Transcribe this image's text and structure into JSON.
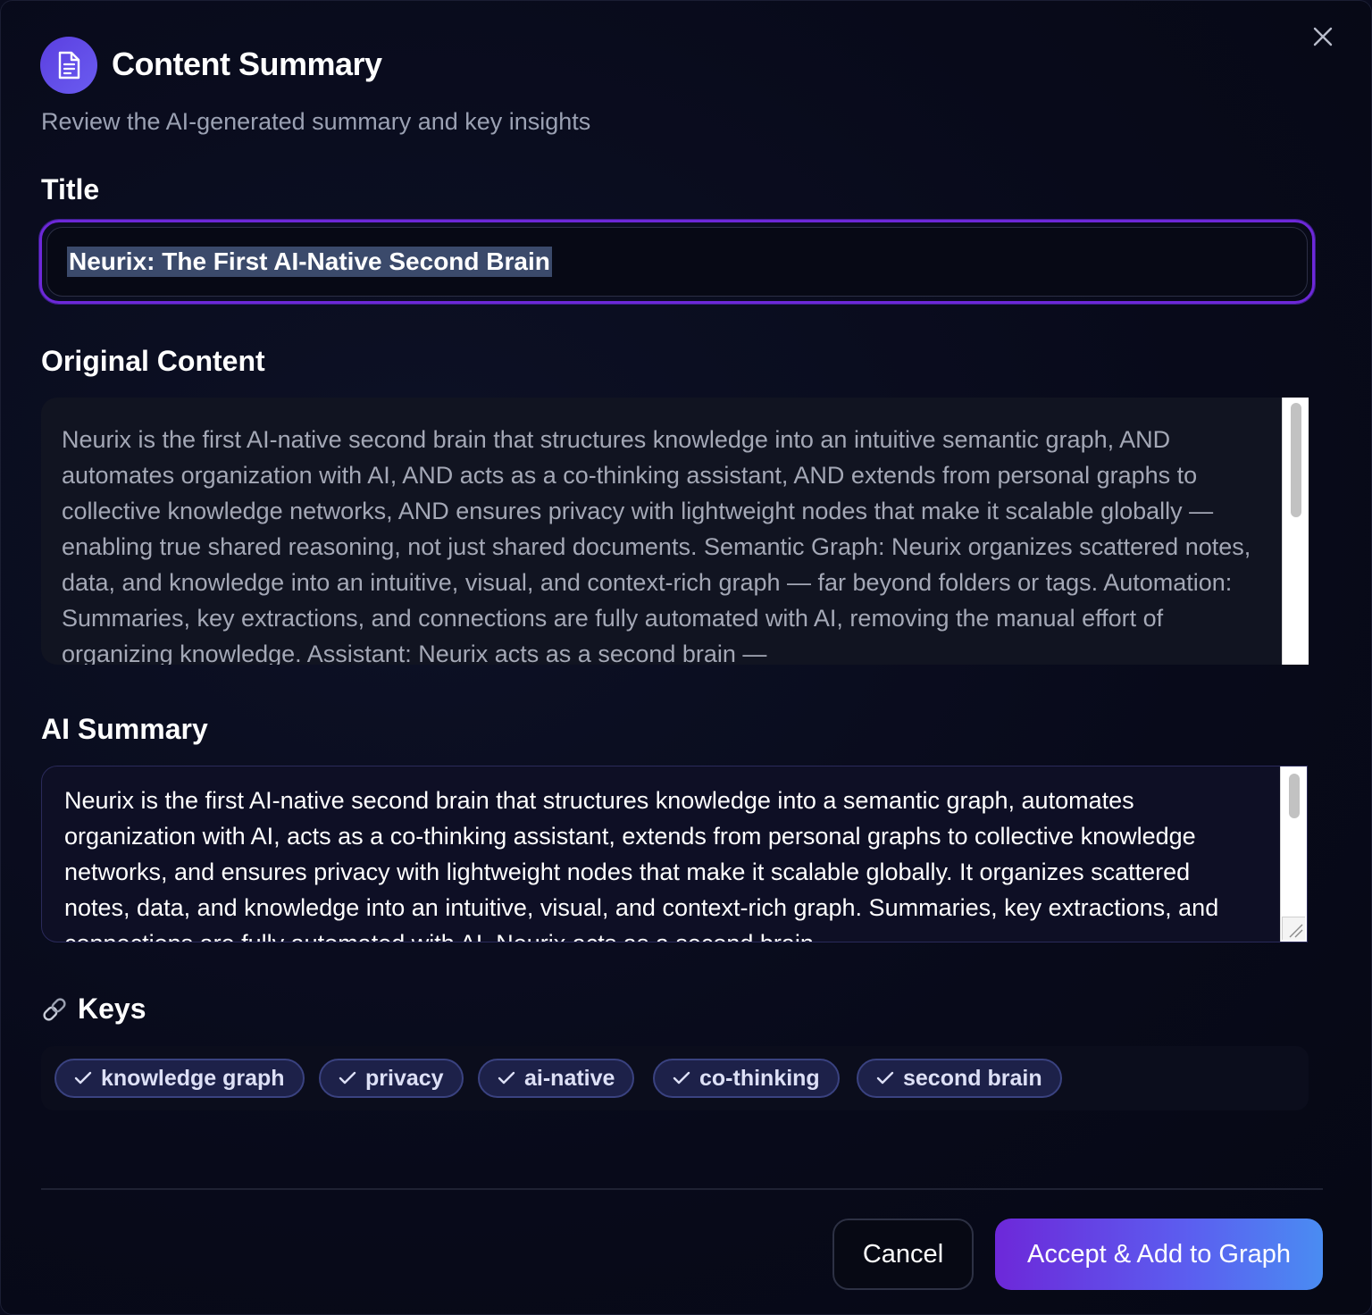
{
  "dialog": {
    "title": "Content Summary",
    "subtitle": "Review the AI-generated summary and key insights",
    "header_icon": "document-icon",
    "close_icon": "close-icon"
  },
  "title_section": {
    "label": "Title",
    "value": "Neurix: The First AI-Native Second Brain"
  },
  "original_section": {
    "label": "Original Content",
    "text": "Neurix is the first AI-native second brain that structures knowledge into an intuitive semantic graph, AND automates organization with AI, AND acts as a co-thinking assistant, AND extends from personal graphs to collective knowledge networks, AND ensures privacy with lightweight nodes that make it scalable globally — enabling true shared reasoning, not just shared documents. Semantic Graph: Neurix organizes scattered notes, data, and knowledge into an intuitive, visual, and context-rich graph — far beyond folders or tags. Automation: Summaries, key extractions, and connections are fully automated with AI, removing the manual effort of organizing knowledge. Assistant: Neurix acts as a second brain —"
  },
  "summary_section": {
    "label": "AI Summary",
    "text": "Neurix is the first AI-native second brain that structures knowledge into a semantic graph, automates organization with AI, acts as a co-thinking assistant, extends from personal graphs to collective knowledge networks, and ensures privacy with lightweight nodes that make it scalable globally. It organizes scattered notes, data, and knowledge into an intuitive, visual, and context-rich graph. Summaries, key extractions, and connections are fully automated with AI. Neurix acts as a second brain"
  },
  "keys_section": {
    "icon": "link-icon",
    "label": "Keys",
    "chips": [
      {
        "label": "knowledge graph"
      },
      {
        "label": "privacy"
      },
      {
        "label": "ai-native"
      },
      {
        "label": "co-thinking"
      },
      {
        "label": "second brain"
      }
    ]
  },
  "footer": {
    "cancel_label": "Cancel",
    "accept_label": "Accept & Add to Graph"
  },
  "colors": {
    "accent": "#6d28d9",
    "background": "#080a1a",
    "chip_bg": "#1d2149"
  }
}
